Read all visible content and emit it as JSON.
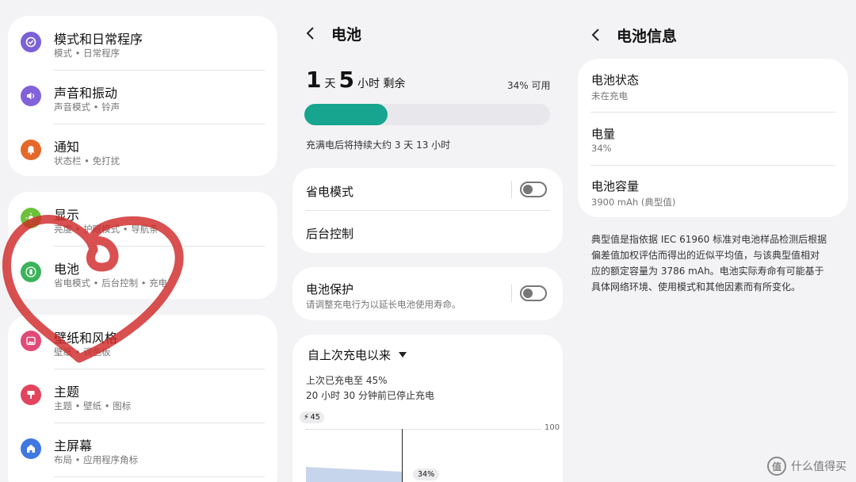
{
  "settings": {
    "items": [
      {
        "title": "模式和日常程序",
        "subtitle": "模式 • 日常程序",
        "icon": "routine-check-icon",
        "color": "#7b61d6"
      },
      {
        "title": "声音和振动",
        "subtitle": "声音模式 • 铃声",
        "icon": "speaker-icon",
        "color": "#8262d8"
      },
      {
        "title": "通知",
        "subtitle": "状态栏 • 免打扰",
        "icon": "bell-icon",
        "color": "#e5682a"
      },
      {
        "title": "显示",
        "subtitle": "亮度 • 护眼模式 • 导航条",
        "icon": "sun-icon",
        "color": "#6dc13a"
      },
      {
        "title": "电池",
        "subtitle": "省电模式 • 后台控制 • 充电",
        "icon": "battery-icon",
        "color": "#3bb35a"
      },
      {
        "title": "壁纸和风格",
        "subtitle": "壁纸 • 调色板",
        "icon": "image-icon",
        "color": "#e04a79"
      },
      {
        "title": "主题",
        "subtitle": "主题 • 壁纸 • 图标",
        "icon": "paintbrush-icon",
        "color": "#e2445d"
      },
      {
        "title": "主屏幕",
        "subtitle": "布局 • 应用程序角标",
        "icon": "home-icon",
        "color": "#3f78e0"
      }
    ]
  },
  "battery": {
    "title": "电池",
    "days": "1",
    "days_unit": "天",
    "hours": "5",
    "hours_unit": "小时 剩余",
    "percent_label": "34% 可用",
    "level": 0.34,
    "full_charge_text": "充满电后将持续大约 3 天 13 小时",
    "power_saving": "省电模式",
    "background_control": "后台控制",
    "protection_title": "电池保护",
    "protection_sub": "请调整充电行为以延长电池使用寿命。",
    "since_label": "自上次充电以来",
    "last_charged": "上次已充电至 45%",
    "stopped_charging": "20 小时 30 分钟前已停止充电",
    "charge_badge": "45",
    "axis_max": "100",
    "current_badge": "34%",
    "accent_color": "#17a58f"
  },
  "battery_info": {
    "title": "电池信息",
    "status_label": "电池状态",
    "status_value": "未在充电",
    "level_label": "电量",
    "level_value": "34%",
    "capacity_label": "电池容量",
    "capacity_value": "3900 mAh (典型值)",
    "note": [
      "典型值是指依据 IEC 61960 标准对电池样品检测后根据",
      "偏差值加权评估而得出的近似平均值，与该典型值相对",
      "应的额定容量为 3786 mAh。电池实际寿命有可能基于",
      "具体网络环境、使用模式和其他因素而有所变化。"
    ]
  },
  "watermark": {
    "logo": "值",
    "text": "什么值得买"
  }
}
